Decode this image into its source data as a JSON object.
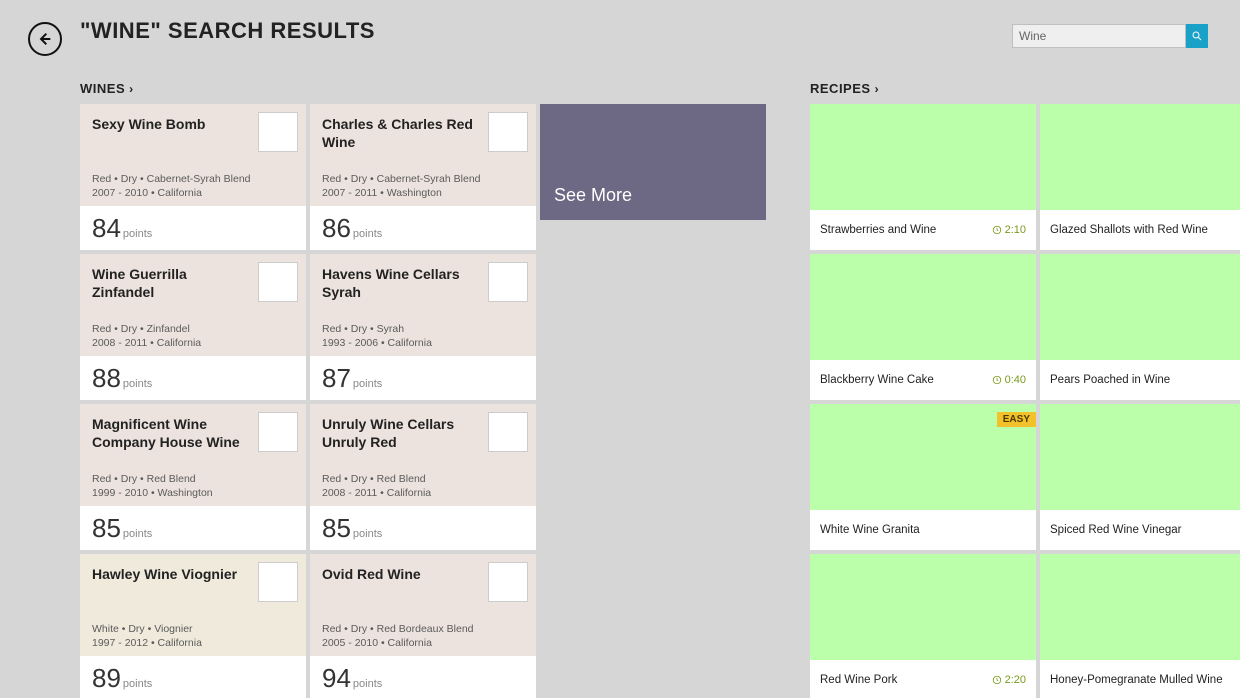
{
  "header": {
    "title": "\"WINE\" SEARCH RESULTS"
  },
  "search": {
    "value": "Wine"
  },
  "sections": {
    "wines_label": "WINES",
    "recipes_label": "RECIPES",
    "see_more": "See More"
  },
  "points_label": "points",
  "wines": [
    {
      "name": "Sexy Wine Bomb",
      "line1": "Red • Dry • Cabernet-Syrah Blend",
      "line2": "2007 - 2010 • California",
      "score": "84",
      "thumb": "lbl-dark"
    },
    {
      "name": "Charles & Charles Red Wine",
      "line1": "Red • Dry • Cabernet-Syrah Blend",
      "line2": "2007 - 2011 • Washington",
      "score": "86",
      "thumb": "lbl-bottle"
    },
    {
      "name": "Wine Guerrilla Zinfandel",
      "line1": "Red • Dry • Zinfandel",
      "line2": "2008 - 2011 • California",
      "score": "88",
      "thumb": "lbl-flag"
    },
    {
      "name": "Havens Wine Cellars Syrah",
      "line1": "Red • Dry • Syrah",
      "line2": "1993 - 2006 • California",
      "score": "87",
      "thumb": "lbl-blue"
    },
    {
      "name": "Magnificent Wine Company House Wine",
      "line1": "Red • Dry • Red Blend",
      "line2": "1999 - 2010 • Washington",
      "score": "85",
      "thumb": "lbl-house"
    },
    {
      "name": "Unruly Wine Cellars Unruly Red",
      "line1": "Red • Dry • Red Blend",
      "line2": "2008 - 2011 • California",
      "score": "85",
      "thumb": "lbl-red"
    },
    {
      "name": "Hawley Wine Viognier",
      "line1": "White • Dry • Viognier",
      "line2": "1997 - 2012 • California",
      "score": "89",
      "thumb": "lbl-cream",
      "alt": true
    },
    {
      "name": "Ovid Red Wine",
      "line1": "Red • Dry • Red Bordeaux Blend",
      "line2": "2005 - 2010 • California",
      "score": "94",
      "thumb": "lbl-paper"
    }
  ],
  "recipes": [
    {
      "title": "Strawberries and Wine",
      "time": "2:10",
      "bg": "bg-strawberry"
    },
    {
      "title": "Glazed Shallots with Red Wine",
      "time": "",
      "bg": "bg-shallots"
    },
    {
      "title": "Blackberry Wine Cake",
      "time": "0:40",
      "bg": "bg-cake"
    },
    {
      "title": "Pears Poached in Wine",
      "time": "",
      "bg": "bg-pear"
    },
    {
      "title": "White Wine Granita",
      "time": "",
      "bg": "bg-granita",
      "badge": "EASY"
    },
    {
      "title": "Spiced Red Wine Vinegar",
      "time": "",
      "bg": "bg-vinegar"
    },
    {
      "title": "Red Wine Pork",
      "time": "2:20",
      "bg": "bg-pork"
    },
    {
      "title": "Honey-Pomegranate Mulled Wine",
      "time": "",
      "bg": "bg-mulled"
    }
  ]
}
